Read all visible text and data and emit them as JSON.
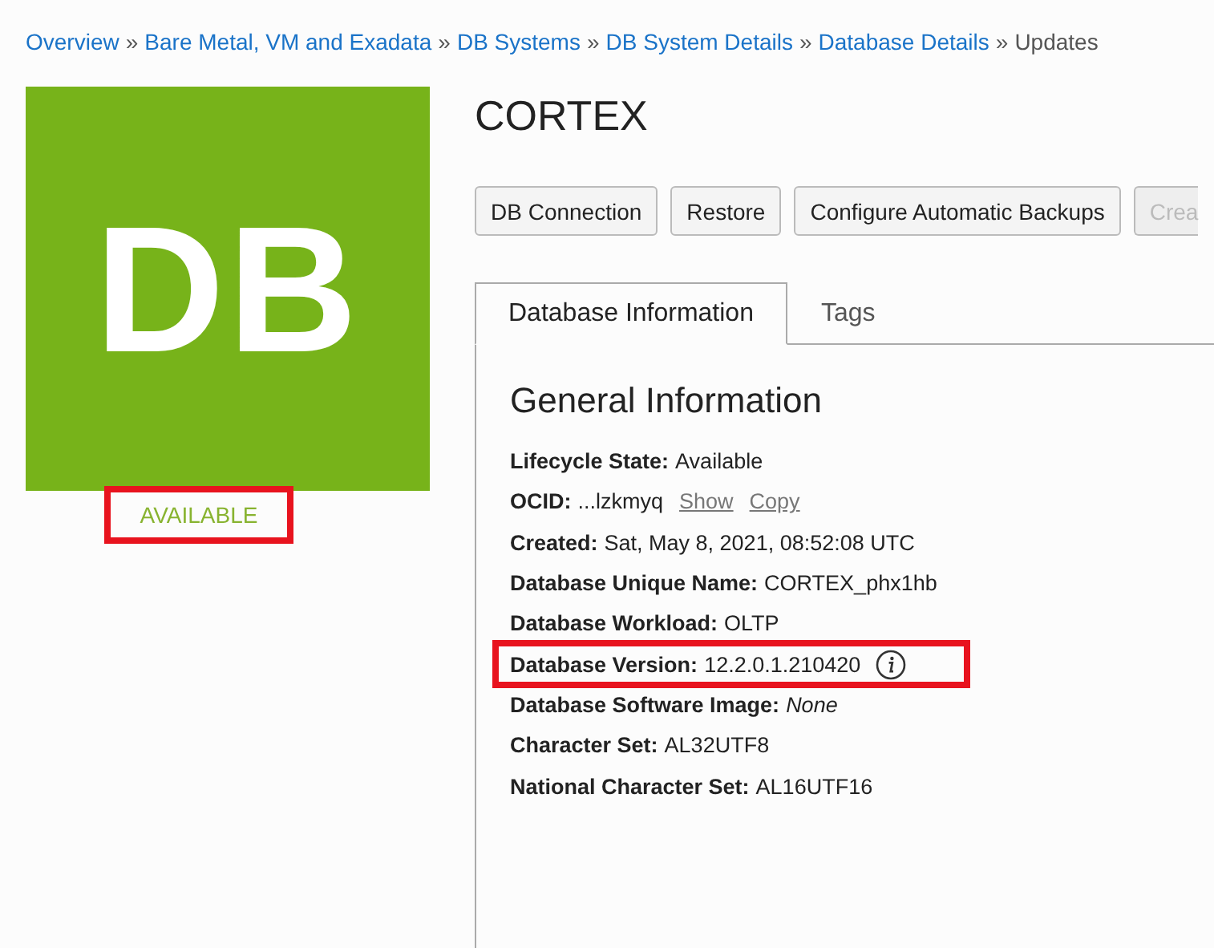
{
  "breadcrumb": {
    "links": [
      {
        "text": "Overview",
        "separator": "»"
      },
      {
        "text": "Bare Metal, VM and Exadata",
        "separator": "»"
      },
      {
        "text": "DB Systems",
        "separator": "»"
      },
      {
        "text": "DB System Details",
        "separator": "»"
      },
      {
        "text": "Database Details",
        "separator": "»"
      }
    ],
    "current": "Updates"
  },
  "tile": {
    "text": "DB"
  },
  "status": {
    "text": "AVAILABLE",
    "highlighted": true
  },
  "title": "CORTEX",
  "buttons": [
    {
      "label": "DB Connection",
      "disabled": false
    },
    {
      "label": "Restore",
      "disabled": false
    },
    {
      "label": "Configure Automatic Backups",
      "disabled": false
    },
    {
      "label": "Crea",
      "disabled": true
    }
  ],
  "tabs": [
    {
      "label": "Database Information",
      "selected": true
    },
    {
      "label": "Tags",
      "selected": false
    }
  ],
  "section_title": "General Information",
  "fields": [
    {
      "label": "Lifecycle State:",
      "value": "Available",
      "italic": false,
      "highlighted": false
    },
    {
      "label": "OCID:",
      "value": "...lzkmyq",
      "links": [
        "Show",
        "Copy"
      ],
      "italic": false,
      "highlighted": false
    },
    {
      "label": "Created:",
      "value": "Sat, May 8, 2021, 08:52:08 UTC",
      "italic": false,
      "highlighted": false
    },
    {
      "label": "Database Unique Name:",
      "value": "CORTEX_phx1hb",
      "italic": false,
      "highlighted": false
    },
    {
      "label": "Database Workload:",
      "value": "OLTP",
      "italic": false,
      "highlighted": false
    },
    {
      "label": "Database Version:",
      "value": "12.2.0.1.210420",
      "info": true,
      "italic": false,
      "highlighted": true
    },
    {
      "label": "Database Software Image:",
      "value": "None",
      "italic": true,
      "highlighted": false
    },
    {
      "label": "Character Set:",
      "value": "AL32UTF8",
      "italic": false,
      "highlighted": false
    },
    {
      "label": "National Character Set:",
      "value": "AL16UTF16",
      "italic": false,
      "highlighted": false
    }
  ]
}
